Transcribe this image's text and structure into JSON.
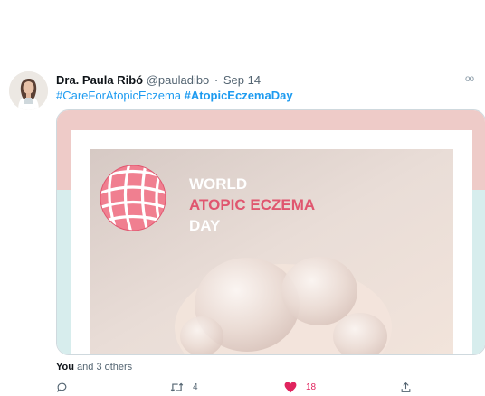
{
  "tweet": {
    "author_name": "Dra. Paula Ribó",
    "handle": "@pauladibo",
    "separator": "·",
    "date": "Sep 14",
    "more_icon": "more-icon",
    "hashtags": [
      "#CareForAtopicEczema",
      "#AtopicEczemaDay"
    ]
  },
  "media": {
    "line1": "WORLD",
    "line2": "ATOPIC ECZEMA",
    "line3": "DAY",
    "frame_top_color": "#eecbc8",
    "frame_bottom_color": "#d7eded",
    "accent_color": "#e0566f"
  },
  "likes": {
    "bold_text": "You",
    "rest_text": "and 3 others"
  },
  "actions": {
    "reply": {
      "icon": "reply-icon"
    },
    "retweet": {
      "icon": "retweet-icon",
      "count": "4"
    },
    "like": {
      "icon": "heart-icon",
      "count": "18",
      "color": "#e0245e"
    },
    "share": {
      "icon": "share-icon"
    }
  }
}
